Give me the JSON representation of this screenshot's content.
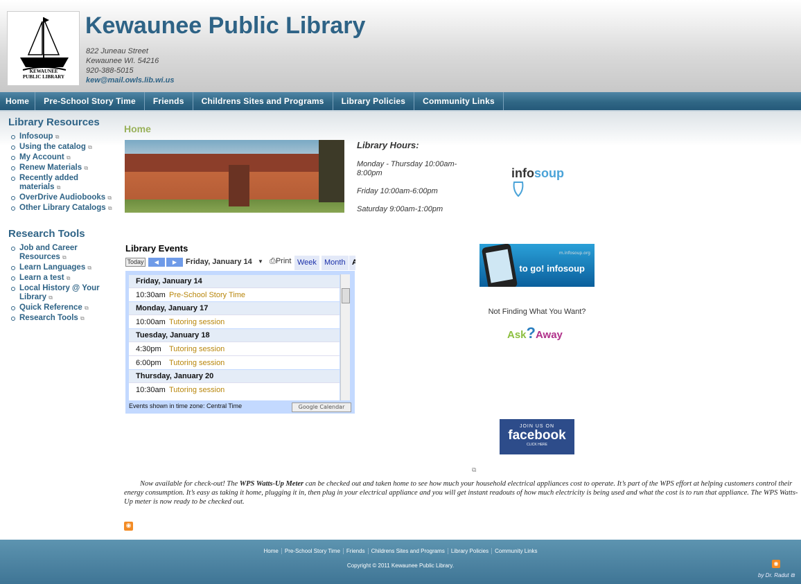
{
  "header": {
    "title": "Kewaunee Public Library",
    "logo_line1": "KEWAUNEE",
    "logo_line2": "PUBLIC LIBRARY",
    "address_line1": "822 Juneau Street",
    "address_line2": "Kewaunee WI. 54216",
    "phone": "920-388-5015",
    "email": "kew@mail.owls.lib.wi.us"
  },
  "nav": [
    "Home",
    "Pre-School Story Time",
    "Friends",
    "Childrens Sites and Programs",
    "Library Policies",
    "Community Links"
  ],
  "sidebar": {
    "resources_heading": "Library Resources",
    "resources": [
      "Infosoup",
      "Using the catalog",
      "My Account",
      "Renew Materials",
      "Recently added materials",
      "OverDrive Audiobooks",
      "Other Library Catalogs"
    ],
    "research_heading": "Research Tools",
    "research": [
      "Job and Career Resources",
      "Learn Languages",
      "Learn a test",
      "Local History @ Your Library",
      "Quick Reference",
      "Research Tools"
    ]
  },
  "main": {
    "title": "Home",
    "hours_heading": "Library Hours:",
    "hours": [
      "Monday - Thursday 10:00am-8:00pm",
      "Friday 10:00am-6:00pm",
      "Saturday 9:00am-1:00pm"
    ],
    "not_finding": "Not Finding What You Want?",
    "infosoup_logo": {
      "part1": "info",
      "part2": "soup"
    },
    "togo": {
      "url": "m.infosoup.org",
      "text": "to go! infosoup"
    },
    "askaway": {
      "a": "Ask",
      "q": "?",
      "b": "Away"
    },
    "facebook": {
      "top": "JOIN US ON",
      "name": "facebook",
      "bottom": "CLICK HERE"
    },
    "story_part1": "Now available for check-out! The ",
    "story_bold1": "WPS Watts-Up Meter",
    "story_part2": " can be checked out and taken home to see how much your household electrical appliances cost to operate. It’s part of the WPS effort at helping customers control their energy consumption. It’s easy as taking it home, plugging it in, then plug in your electrical appliance and you will get instant readouts of how much electricity is being used and what the cost is to run that appliance. The WPS Watts-Up meter is now ready to be checked out."
  },
  "calendar": {
    "title": "Library Events",
    "today": "Today",
    "prev": "◀",
    "next": "▶",
    "date": "Friday, January 14",
    "print": "Print",
    "week": "Week",
    "month": "Month",
    "agenda": "A",
    "timezone": "Events shown in time zone: Central Time",
    "gcal": "Google Calendar",
    "days": [
      {
        "label": "Friday, January 14",
        "events": [
          {
            "time": "10:30am",
            "name": "Pre-School Story Time"
          }
        ]
      },
      {
        "label": "Monday, January 17",
        "events": [
          {
            "time": "10:00am",
            "name": "Tutoring session"
          }
        ]
      },
      {
        "label": "Tuesday, January 18",
        "events": [
          {
            "time": "4:30pm",
            "name": "Tutoring session"
          },
          {
            "time": "6:00pm",
            "name": "Tutoring session"
          }
        ]
      },
      {
        "label": "Thursday, January 20",
        "events": [
          {
            "time": "10:30am",
            "name": "Tutoring session"
          }
        ]
      }
    ]
  },
  "footer": {
    "nav": [
      "Home",
      "Pre-School Story Time",
      "Friends",
      "Childrens Sites and Programs",
      "Library Policies",
      "Community Links"
    ],
    "copyright": "Copyright © 2011 Kewaunee Public Library.",
    "credit": "by Dr. Radut"
  }
}
